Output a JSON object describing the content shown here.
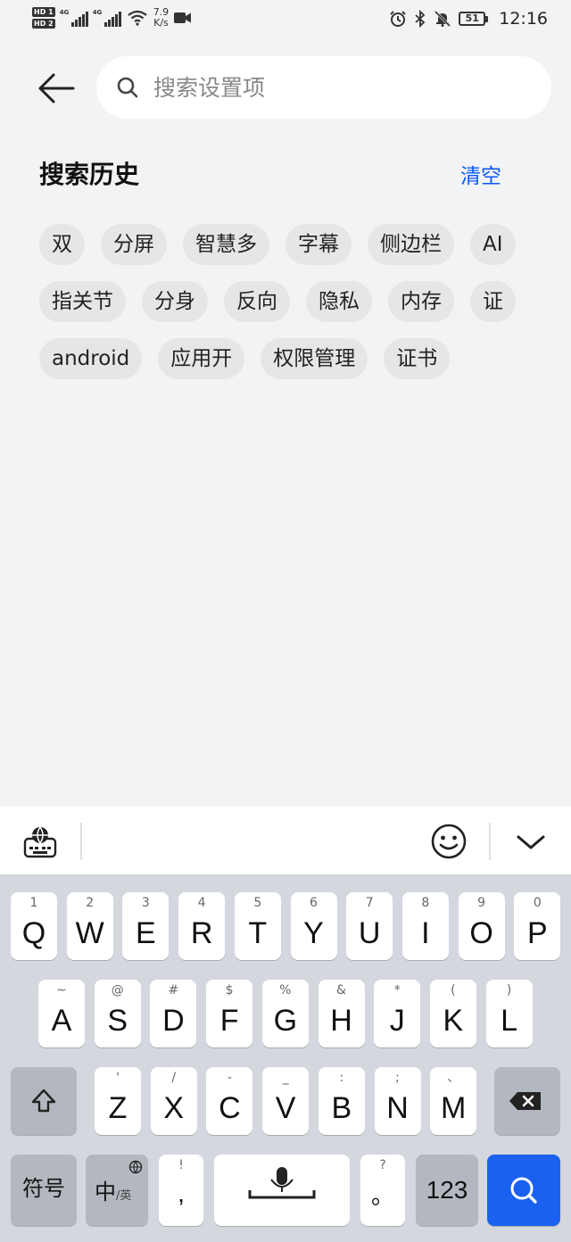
{
  "status_bar": {
    "network_speed_value": "7.9",
    "network_speed_unit": "K/s",
    "hd1": "HD 1",
    "hd2": "HD 2",
    "signal_label": "4G",
    "battery": "51",
    "time": "12:16"
  },
  "header": {
    "search_placeholder": "搜索设置项"
  },
  "history": {
    "title": "搜索历史",
    "clear_label": "清空",
    "rows": [
      [
        "双",
        "分屏",
        "智慧多",
        "字幕",
        "侧边栏",
        "AI"
      ],
      [
        "指关节",
        "分身",
        "反向",
        "隐私",
        "内存",
        "证"
      ],
      [
        "android",
        "应用开",
        "权限管理",
        "证书"
      ]
    ]
  },
  "keyboard": {
    "row1": [
      {
        "hint": "1",
        "label": "Q"
      },
      {
        "hint": "2",
        "label": "W"
      },
      {
        "hint": "3",
        "label": "E"
      },
      {
        "hint": "4",
        "label": "R"
      },
      {
        "hint": "5",
        "label": "T"
      },
      {
        "hint": "6",
        "label": "Y"
      },
      {
        "hint": "7",
        "label": "U"
      },
      {
        "hint": "8",
        "label": "I"
      },
      {
        "hint": "9",
        "label": "O"
      },
      {
        "hint": "0",
        "label": "P"
      }
    ],
    "row2": [
      {
        "hint": "~",
        "label": "A"
      },
      {
        "hint": "@",
        "label": "S"
      },
      {
        "hint": "#",
        "label": "D"
      },
      {
        "hint": "$",
        "label": "F"
      },
      {
        "hint": "%",
        "label": "G"
      },
      {
        "hint": "&",
        "label": "H"
      },
      {
        "hint": "*",
        "label": "J"
      },
      {
        "hint": "(",
        "label": "K"
      },
      {
        "hint": ")",
        "label": "L"
      }
    ],
    "row3": [
      {
        "hint": "'",
        "label": "Z"
      },
      {
        "hint": "/",
        "label": "X"
      },
      {
        "hint": "-",
        "label": "C"
      },
      {
        "hint": "_",
        "label": "V"
      },
      {
        "hint": ":",
        "label": "B"
      },
      {
        "hint": ";",
        "label": "N"
      },
      {
        "hint": "、",
        "label": "M"
      }
    ],
    "symbols_label": "符号",
    "lang_label": "中",
    "lang_sub": "/英",
    "comma_hint": "!",
    "comma_label": ",",
    "period_hint": "?",
    "period_label": "。",
    "num_label": "123"
  },
  "colors": {
    "accent": "#0a59f7",
    "search_key": "#1a61f0",
    "chip_bg": "#e5e6e8",
    "page_bg": "#f1f3f5",
    "keyboard_bg": "#d4d7dd"
  }
}
